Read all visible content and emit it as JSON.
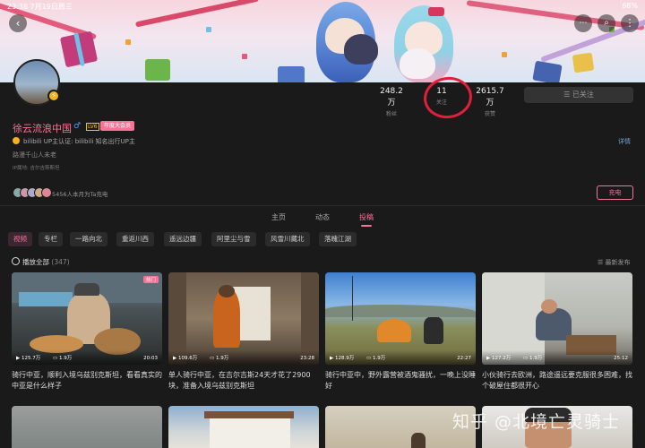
{
  "status_bar": {
    "time_date": "23:38  7月19日周三",
    "right": "68%"
  },
  "profile": {
    "name": "徐云流浪中国",
    "gender_icon": "male",
    "level": "LV6",
    "vip_badge": "年度大会员",
    "verify": "bilibili  UP主认证: bilibili  知名出行UP主",
    "signature": "路漫千山人未老",
    "ip": "IP属地: 吉尔吉斯斯坦",
    "detail_link": "详情",
    "charge_text": "5456人本月为Ta充电",
    "charge_button": "充电",
    "follow_button": "已关注"
  },
  "stats": [
    {
      "value": "248.2万",
      "label": "粉丝"
    },
    {
      "value": "11",
      "label": "关注"
    },
    {
      "value": "2615.7万",
      "label": "获赞"
    }
  ],
  "tabs": [
    "主页",
    "动态",
    "投稿"
  ],
  "active_tab": 2,
  "chips": [
    "视频",
    "专栏",
    "一路向北",
    "重返川西",
    "遥远边疆",
    "阿里尘与雪",
    "风雪川藏北",
    "落魄江湖"
  ],
  "play_all": {
    "label": "播放全部",
    "count": "(347)"
  },
  "sort_label": "最新发布",
  "videos": [
    {
      "plays": "125.7万",
      "danmaku": "1.9万",
      "duration": "20:03",
      "title": "骑行中亚，顺利入境乌兹别克斯坦，看看真实的中亚是什么样子",
      "tag": "热门"
    },
    {
      "plays": "109.6万",
      "danmaku": "1.9万",
      "duration": "23:28",
      "title": "单人骑行中亚，在吉尔吉斯24天才花了2900块，准备入境乌兹别克斯坦"
    },
    {
      "plays": "128.9万",
      "danmaku": "1.9万",
      "duration": "22:27",
      "title": "骑行中亚中，野外露营被酒鬼骚扰，一晚上没睡好"
    },
    {
      "plays": "127.2万",
      "danmaku": "1.9万",
      "duration": "25:12",
      "title": "小伙骑行去欧洲，路途遥远要克服很多困难，找个破屋住都很开心"
    }
  ],
  "watermark": "知乎 @北境亡灵骑士",
  "colors": {
    "accent": "#fb7299",
    "annotation": "#e0203a",
    "background": "#1a1a1a"
  },
  "icons": [
    "back-icon",
    "more-icon",
    "search-icon",
    "menu-icon"
  ]
}
